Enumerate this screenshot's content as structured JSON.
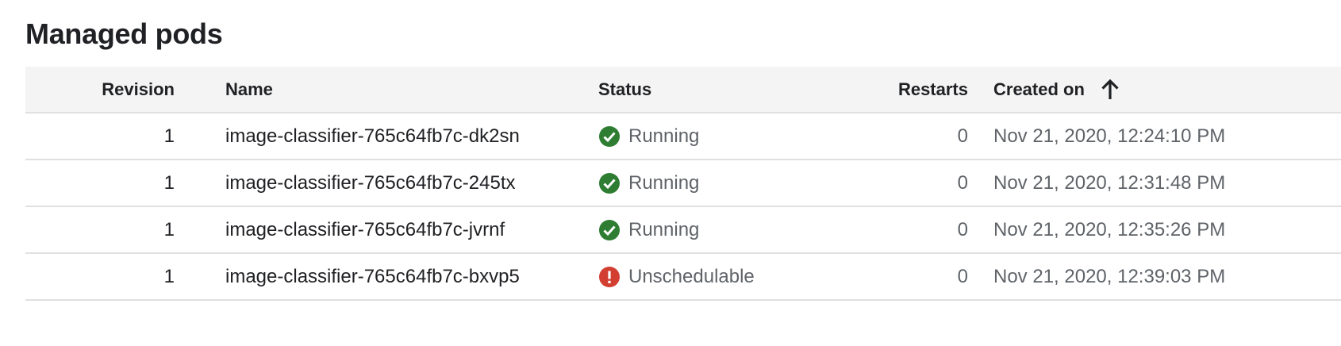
{
  "page": {
    "title": "Managed pods"
  },
  "table": {
    "columns": {
      "revision": "Revision",
      "name": "Name",
      "status": "Status",
      "restarts": "Restarts",
      "created_on": "Created on"
    },
    "sort": {
      "column": "created_on",
      "direction": "ascending",
      "icon": "arrow-up-icon"
    },
    "rows": [
      {
        "revision": "1",
        "name": "image-classifier-765c64fb7c-dk2sn",
        "status": "Running",
        "status_icon": "check-circle-icon",
        "restarts": "0",
        "created_on": "Nov 21, 2020, 12:24:10 PM"
      },
      {
        "revision": "1",
        "name": "image-classifier-765c64fb7c-245tx",
        "status": "Running",
        "status_icon": "check-circle-icon",
        "restarts": "0",
        "created_on": "Nov 21, 2020, 12:31:48 PM"
      },
      {
        "revision": "1",
        "name": "image-classifier-765c64fb7c-jvrnf",
        "status": "Running",
        "status_icon": "check-circle-icon",
        "restarts": "0",
        "created_on": "Nov 21, 2020, 12:35:26 PM"
      },
      {
        "revision": "1",
        "name": "image-classifier-765c64fb7c-bxvp5",
        "status": "Unschedulable",
        "status_icon": "error-circle-icon",
        "restarts": "0",
        "created_on": "Nov 21, 2020, 12:39:03 PM"
      }
    ]
  },
  "colors": {
    "success": "#2e7d32",
    "error": "#d23f31",
    "header_bg": "#f4f4f4",
    "divider": "#e0e0e0"
  }
}
